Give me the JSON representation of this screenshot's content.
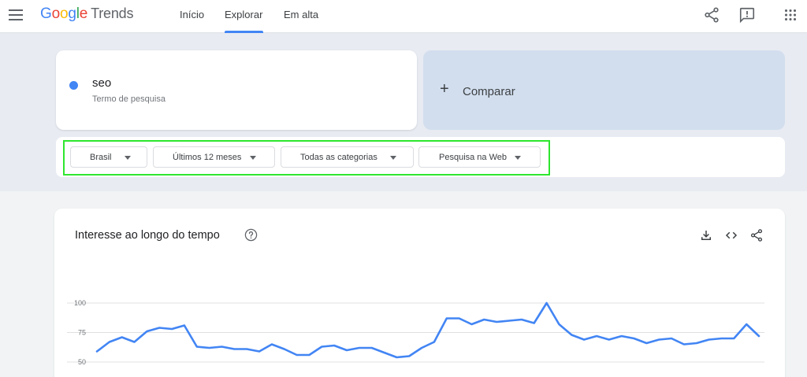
{
  "header": {
    "brand": {
      "google": [
        "G",
        "o",
        "o",
        "g",
        "l",
        "e"
      ],
      "product": "Trends"
    },
    "tabs": [
      {
        "label": "Início"
      },
      {
        "label": "Explorar"
      },
      {
        "label": "Em alta"
      }
    ],
    "icons": [
      "menu-icon",
      "share-icon",
      "feedback-icon",
      "apps-icon"
    ]
  },
  "search_term": {
    "name": "seo",
    "type_label": "Termo de pesquisa",
    "color": "#4285f4"
  },
  "compare": {
    "label": "Comparar"
  },
  "filters": {
    "region": "Brasil",
    "period": "Últimos 12 meses",
    "category": "Todas as categorias",
    "search_type": "Pesquisa na Web",
    "highlight_color": "#2ee62e"
  },
  "chart_card": {
    "title": "Interesse ao longo do tempo",
    "icons": [
      "help-icon",
      "download-icon",
      "embed-icon",
      "share-icon"
    ]
  },
  "chart_data": {
    "type": "line",
    "title": "Interesse ao longo do tempo",
    "xlabel": "",
    "ylabel": "",
    "y_ticks": [
      "100",
      "75",
      "50"
    ],
    "ylim": [
      50,
      100
    ],
    "grid": true,
    "series": [
      {
        "color": "#4285f4",
        "values": [
          59,
          67,
          71,
          67,
          76,
          79,
          78,
          81,
          63,
          62,
          63,
          61,
          61,
          59,
          65,
          61,
          56,
          56,
          63,
          64,
          60,
          62,
          62,
          58,
          54,
          55,
          62,
          67,
          87,
          87,
          82,
          86,
          84,
          85,
          86,
          83,
          100,
          82,
          73,
          69,
          72,
          69,
          72,
          70,
          66,
          69,
          70,
          65,
          66,
          69,
          70,
          70,
          82,
          72
        ]
      }
    ]
  }
}
